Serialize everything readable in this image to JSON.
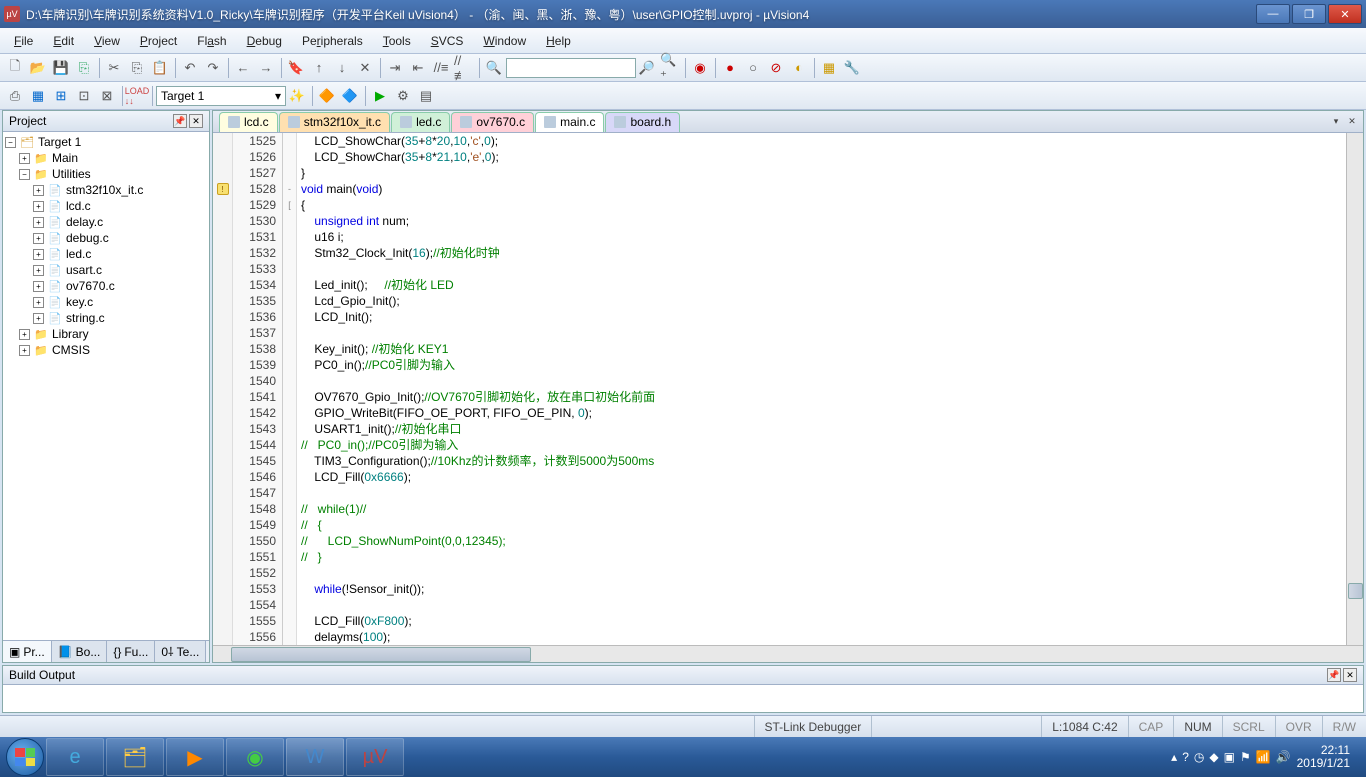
{
  "titlebar": {
    "text": "D:\\车牌识别\\车牌识别系统资料V1.0_Ricky\\车牌识别程序（开发平台Keil uVision4） - （渝、闽、黑、浙、豫、粤）\\user\\GPIO控制.uvproj - µVision4"
  },
  "menubar": [
    "File",
    "Edit",
    "View",
    "Project",
    "Flash",
    "Debug",
    "Peripherals",
    "Tools",
    "SVCS",
    "Window",
    "Help"
  ],
  "toolbar2": {
    "target": "Target 1"
  },
  "project": {
    "title": "Project",
    "root": "Target 1",
    "folders": [
      {
        "name": "Main",
        "expanded": false
      },
      {
        "name": "Utilities",
        "expanded": true,
        "files": [
          "stm32f10x_it.c",
          "lcd.c",
          "delay.c",
          "debug.c",
          "led.c",
          "usart.c",
          "ov7670.c",
          "key.c",
          "string.c"
        ]
      },
      {
        "name": "Library",
        "expanded": false
      },
      {
        "name": "CMSIS",
        "expanded": false
      }
    ],
    "tabs": [
      "Pr...",
      "Bo...",
      "Fu...",
      "Te..."
    ]
  },
  "fileTabs": [
    {
      "label": "lcd.c",
      "cls": "t1"
    },
    {
      "label": "stm32f10x_it.c",
      "cls": "t2"
    },
    {
      "label": "led.c",
      "cls": "t3"
    },
    {
      "label": "ov7670.c",
      "cls": "t4"
    },
    {
      "label": "main.c",
      "cls": "active"
    },
    {
      "label": "board.h",
      "cls": "t5"
    }
  ],
  "code": {
    "startLine": 1525,
    "lines": [
      {
        "n": 1525,
        "t": "    LCD_ShowChar(35+8*20,10,'c',0);"
      },
      {
        "n": 1526,
        "t": "    LCD_ShowChar(35+8*21,10,'e',0);"
      },
      {
        "n": 1527,
        "t": "}"
      },
      {
        "n": 1528,
        "t": "void main(void)",
        "warn": true,
        "fold": "-"
      },
      {
        "n": 1529,
        "t": "{",
        "fold": "["
      },
      {
        "n": 1530,
        "t": "    unsigned int num;"
      },
      {
        "n": 1531,
        "t": "    u16 i;"
      },
      {
        "n": 1532,
        "t": "    Stm32_Clock_Init(16);",
        "c": "//初始化时钟"
      },
      {
        "n": 1533,
        "t": ""
      },
      {
        "n": 1534,
        "t": "    Led_init();     ",
        "c": "//初始化 LED"
      },
      {
        "n": 1535,
        "t": "    Lcd_Gpio_Init();"
      },
      {
        "n": 1536,
        "t": "    LCD_Init();"
      },
      {
        "n": 1537,
        "t": ""
      },
      {
        "n": 1538,
        "t": "    Key_init(); ",
        "c": "//初始化 KEY1"
      },
      {
        "n": 1539,
        "t": "    PC0_in();",
        "c": "//PC0引脚为输入"
      },
      {
        "n": 1540,
        "t": ""
      },
      {
        "n": 1541,
        "t": "    OV7670_Gpio_Init();",
        "c": "//OV7670引脚初始化，放在串口初始化前面"
      },
      {
        "n": 1542,
        "t": "    GPIO_WriteBit(FIFO_OE_PORT, FIFO_OE_PIN, 0);"
      },
      {
        "n": 1543,
        "t": "    USART1_init();",
        "c": "//初始化串口"
      },
      {
        "n": 1544,
        "t": "",
        "c": "//   PC0_in();//PC0引脚为输入"
      },
      {
        "n": 1545,
        "t": "    TIM3_Configuration();",
        "c": "//10Khz的计数频率，计数到5000为500ms"
      },
      {
        "n": 1546,
        "t": "    LCD_Fill(0x6666);"
      },
      {
        "n": 1547,
        "t": ""
      },
      {
        "n": 1548,
        "t": "",
        "c": "//   while(1)//"
      },
      {
        "n": 1549,
        "t": "",
        "c": "//   {"
      },
      {
        "n": 1550,
        "t": "",
        "c": "//      LCD_ShowNumPoint(0,0,12345);"
      },
      {
        "n": 1551,
        "t": "",
        "c": "//   }"
      },
      {
        "n": 1552,
        "t": ""
      },
      {
        "n": 1553,
        "t": "    while(!Sensor_init());"
      },
      {
        "n": 1554,
        "t": ""
      },
      {
        "n": 1555,
        "t": "    LCD_Fill(0xF800);"
      },
      {
        "n": 1556,
        "t": "    delayms(100);"
      }
    ]
  },
  "buildOutput": {
    "title": "Build Output"
  },
  "statusbar": {
    "debugger": "ST-Link Debugger",
    "pos": "L:1084 C:42",
    "flags": [
      "CAP",
      "NUM",
      "SCRL",
      "OVR",
      "R/W"
    ]
  },
  "taskbar": {
    "time": "22:11",
    "date": "2019/1/21"
  }
}
